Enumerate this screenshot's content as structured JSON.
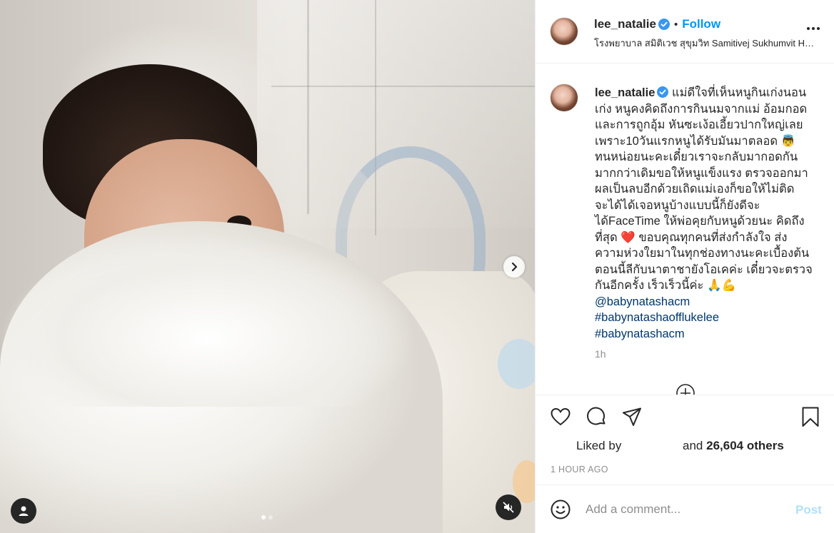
{
  "post": {
    "username": "lee_natalie",
    "follow_label": "Follow",
    "header_dot": "•",
    "location": "โรงพยาบาล สมิติเวช สุขุมวิท Samitivej Sukhumvit Hospital",
    "caption_lines": "แม่ดีใจที่เห็นหนูกินเก่งนอน\nเก่ง หนูคงคิดถึงการกินนมจากแม่ อ้อมกอด\nและการถูกอุ้ม หันซะเง้อเอี้ยวปากใหญ่เลย\nเพราะ10วันแรกหนูได้รับมันมาตลอด 👼\nทนหน่อยนะคะเดี๋ยวเราจะกลับมากอดกัน\nมากกว่าเดิมขอให้หนูแข็งแรง ตรวจออกมา\nผลเป็นลบอีกด้วยเถิดแม่เองก็ขอให้ไม่ติด\nจะได้ได้เจอหนูบ้างแบบนี้ก็ยังดีจะ\nได้FaceTime ให้พ่อคุยกับหนูด้วยนะ คิดถึง\nที่สุด ❤️ ขอบคุณทุกคนที่ส่งกำลังใจ ส่ง\nความห่วงใยมาในทุกช่องทางนะคะเบื้องต้น\nตอนนี้ลีกับนาตาชายังโอเคค่ะ เดี๋ยวจะตรวจ\nกันอีกครั้ง เร็วเร็วนี้ค่ะ 🙏💪",
    "hashtags": [
      "@babynatashacm",
      "#babynatashaofflukelee",
      "#babynatashacm"
    ],
    "time_ago": "1h",
    "liked_by_label": "Liked by",
    "and_label": "and",
    "likes_others": "26,604 others",
    "posted_ago": "1 HOUR AGO",
    "comment_placeholder": "Add a comment...",
    "post_label": "Post"
  },
  "carousel": {
    "dots": 2,
    "active_dot": 1
  },
  "colors": {
    "accent": "#0095f6",
    "verified": "#3897f0",
    "hashtag": "#00376b",
    "muted": "#8e8e8e"
  },
  "icons": [
    "verified-icon",
    "more-options-icon",
    "next-arrow-icon",
    "user-tag-icon",
    "muted-speaker-icon",
    "load-more-icon",
    "heart-icon",
    "comment-icon",
    "share-icon",
    "bookmark-icon",
    "emoji-icon"
  ]
}
